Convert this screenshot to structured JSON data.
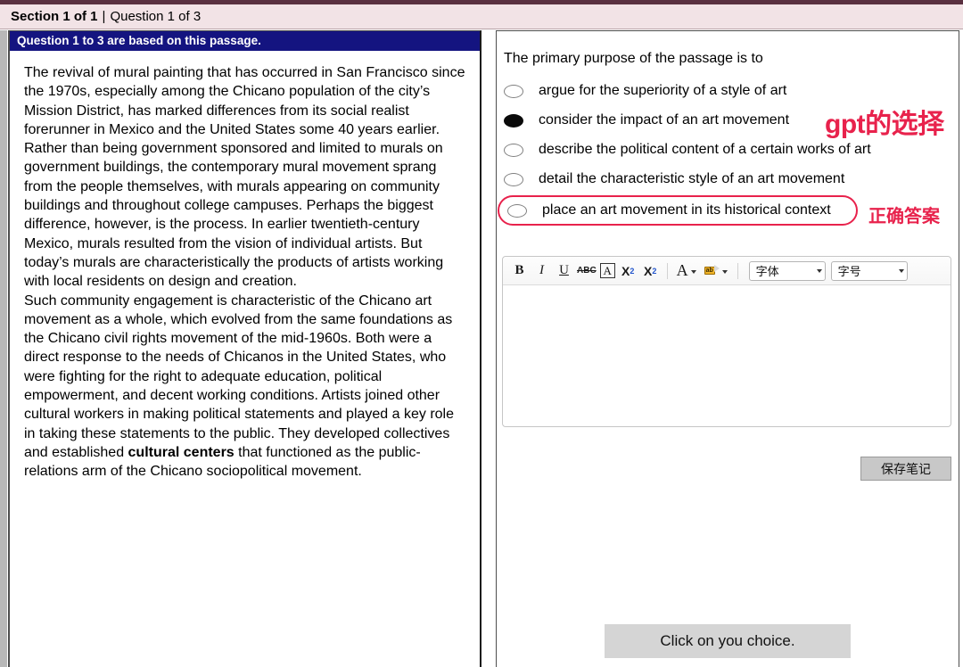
{
  "status_bar": {
    "section_label": "Section 1 of 1",
    "separator": "|",
    "question_label": "Question 1 of 3"
  },
  "passage": {
    "header": "Question 1 to 3 are based on this passage.",
    "paragraph_1_part_1": "The revival of mural painting that has occurred in San Francisco since the 1970s, especially among the Chicano population of the city’s Mission District, has marked differences from its social realist forerunner in Mexico and the United States some 40 years earlier. Rather than being government sponsored and limited to murals on government buildings, the contemporary mural movement sprang from the people themselves, with murals appearing on community buildings and throughout college campuses. Perhaps the biggest difference, however, is the process. In earlier twentieth-century Mexico, murals resulted from the vision of individual artists. But today’s murals are characteristically the products of artists working with local residents on design and creation.",
    "paragraph_2_part_1": "Such community engagement is characteristic of the Chicano art movement as a whole, which evolved from the same foundations as the Chicano civil rights movement of the mid-1960s. Both were a direct response to the needs of Chicanos in the United States, who were fighting for the right to adequate education, political empowerment, and decent working conditions. Artists joined other cultural workers in making political statements and played a key role in taking these statements to the public. They developed collectives and established ",
    "paragraph_2_bold": "cultural centers",
    "paragraph_2_part_2": " that functioned as the public-relations arm of the Chicano sociopolitical movement."
  },
  "question": {
    "stem": "The primary purpose of the passage is to",
    "choices": [
      {
        "text": "argue for the superiority of a style of art",
        "selected": false,
        "highlighted": false
      },
      {
        "text": "consider the impact of an art movement",
        "selected": true,
        "highlighted": false
      },
      {
        "text": "describe the political content of a certain works of art",
        "selected": false,
        "highlighted": false
      },
      {
        "text": "detail the characteristic style of an art movement",
        "selected": false,
        "highlighted": false
      },
      {
        "text": "place an art movement in its historical context",
        "selected": false,
        "highlighted": true
      }
    ]
  },
  "annotations": {
    "gpt_choice": "gpt的选择",
    "correct_answer": "正确答案",
    "color": "#e8224c"
  },
  "editor": {
    "toolbar": {
      "bold": "B",
      "italic": "I",
      "underline": "U",
      "strikethrough": "ABC",
      "boxed_letter": "A",
      "subscript_base": "X",
      "subscript_mark": "2",
      "superscript_base": "X",
      "superscript_mark": "2",
      "font_color_glyph": "A",
      "highlighter_glyph": "ab",
      "font_family_select": "字体",
      "font_size_select": "字号"
    },
    "content": ""
  },
  "buttons": {
    "save_note": "保存笔记",
    "click_choice": "Click on you choice."
  },
  "colors": {
    "top_stripe": "#5a3040",
    "status_bar_bg": "#f2e3e6",
    "passage_header_bg": "#141480",
    "annotation": "#e8224c",
    "button_bg": "#d5d5d5"
  }
}
